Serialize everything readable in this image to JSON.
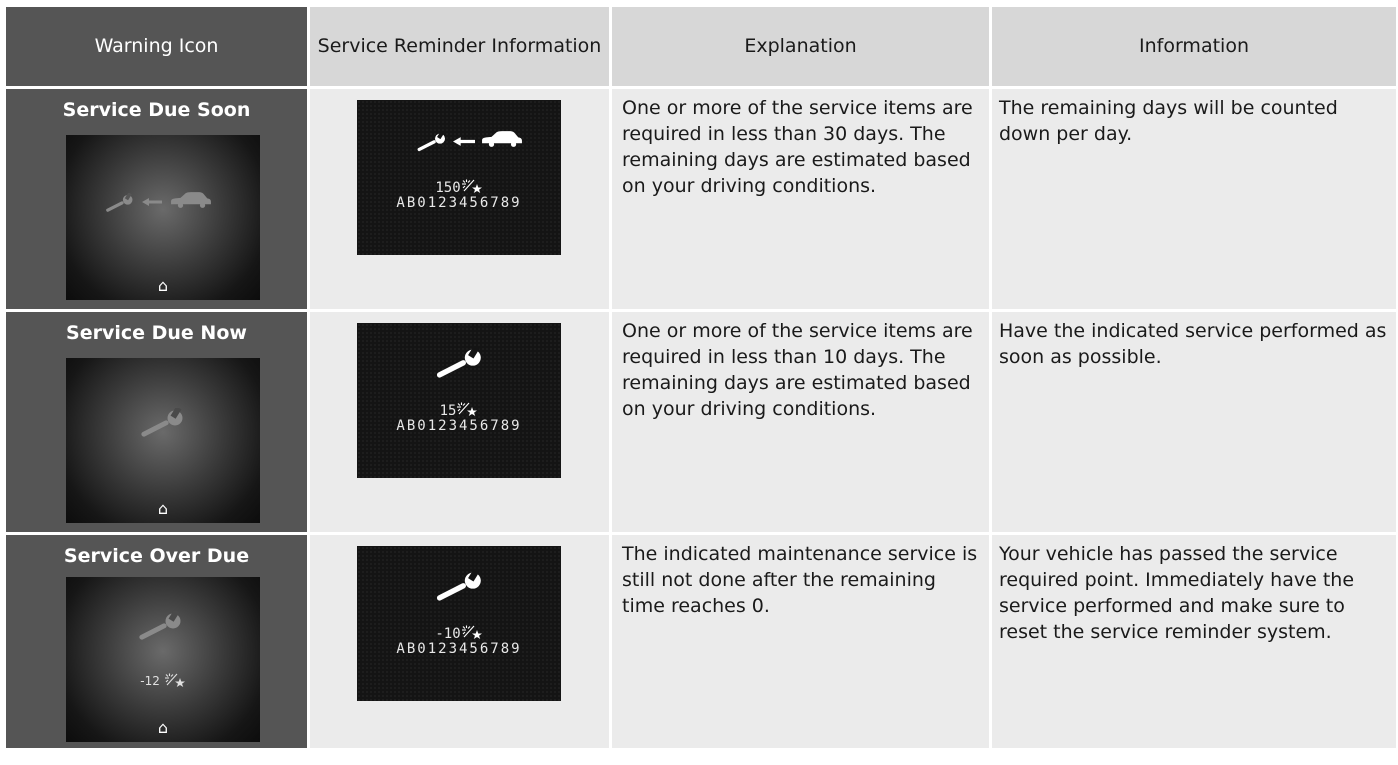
{
  "headers": {
    "warning_icon": "Warning Icon",
    "service_reminder": "Service Reminder Information",
    "explanation": "Explanation",
    "information": "Information"
  },
  "rows": [
    {
      "title": "Service Due Soon",
      "warning_display": {
        "icons": [
          "wrench-icon",
          "arrow-left-icon",
          "car-icon"
        ],
        "value": ""
      },
      "reminder_display": {
        "icons": [
          "wrench-icon",
          "arrow-left-icon",
          "car-icon"
        ],
        "value": "150",
        "code": "AB0123456789"
      },
      "explanation": "One or more of the service items are required in less than 30 days. The remaining days are estimated based on your driving conditions.",
      "information": "The remaining days will be counted down per day."
    },
    {
      "title": "Service Due Now",
      "warning_display": {
        "icons": [
          "wrench-icon"
        ],
        "value": ""
      },
      "reminder_display": {
        "icons": [
          "wrench-icon"
        ],
        "value": "15",
        "code": "AB0123456789"
      },
      "explanation": "One or more of the service items are required in less than 10 days. The remaining days are estimated based on your driving conditions.",
      "information": "Have the indicated service performed as soon as possible."
    },
    {
      "title": "Service Over Due",
      "warning_display": {
        "icons": [
          "wrench-icon"
        ],
        "value": "-12"
      },
      "reminder_display": {
        "icons": [
          "wrench-icon"
        ],
        "value": "-10",
        "code": "AB0123456789"
      },
      "explanation": "The indicated maintenance service is still not done after the remaining time reaches 0.",
      "information": "Your vehicle has passed the service required point. Immediately have the service performed and make sure to reset the service reminder system."
    }
  ],
  "colors": {
    "warning_cell": "#555555",
    "header": "#d7d7d7",
    "body_cell": "#ebebeb"
  }
}
